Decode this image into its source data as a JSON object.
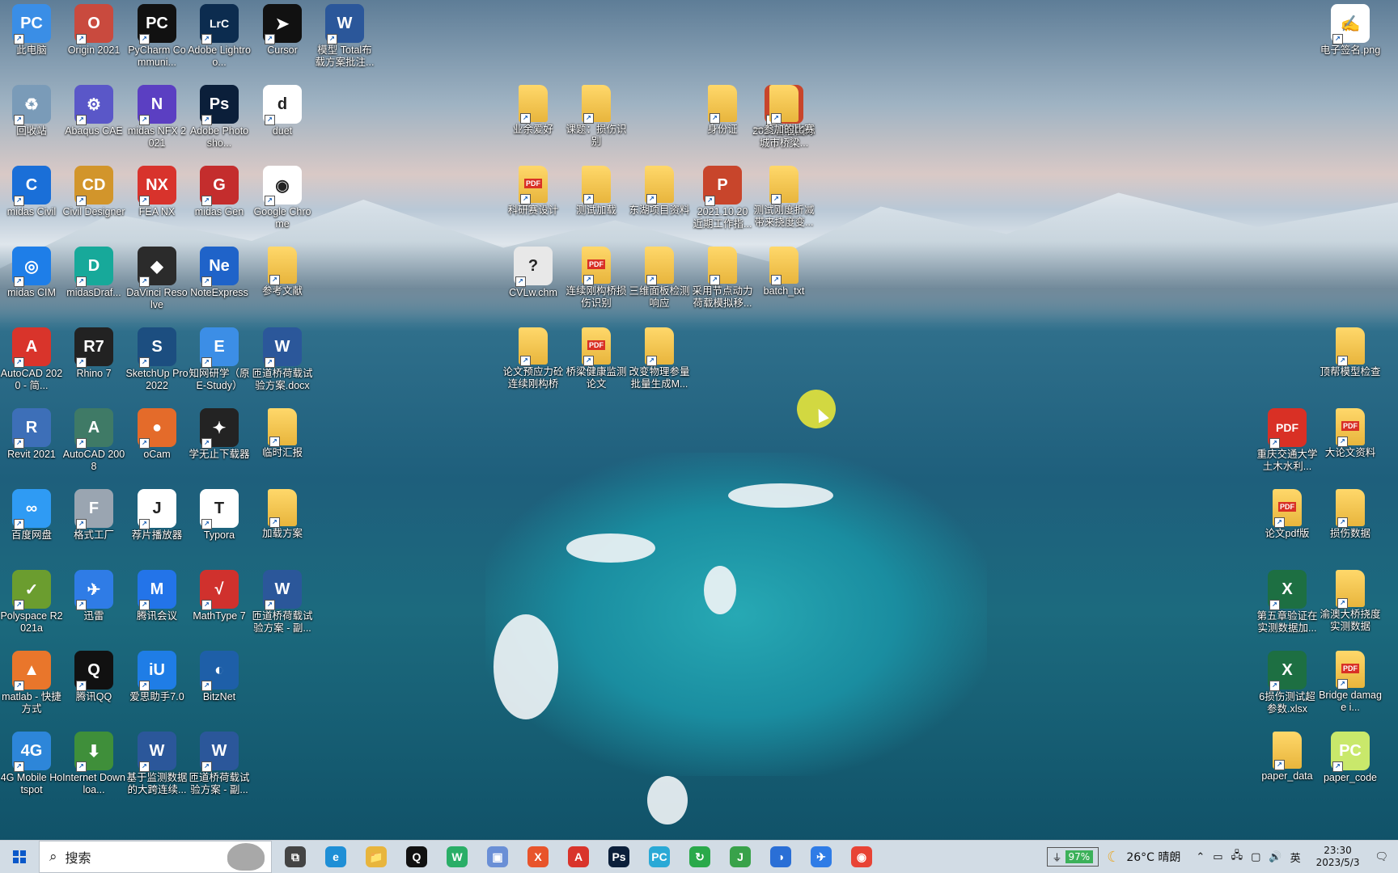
{
  "desktop": {
    "col1": [
      {
        "label": "此电脑",
        "color": "#3a8ee6",
        "glyph": "PC",
        "name": "this-pc"
      },
      {
        "label": "回收站",
        "color": "#7a9bb8",
        "glyph": "♻",
        "name": "recycle-bin"
      },
      {
        "label": "midas Civil",
        "color": "#1a6fd8",
        "glyph": "C",
        "name": "midas-civil"
      },
      {
        "label": "midas CIM",
        "color": "#1e7ee8",
        "glyph": "◎",
        "name": "midas-cim"
      },
      {
        "label": "AutoCAD 2020 - 简...",
        "color": "#d9342b",
        "glyph": "A",
        "name": "autocad-2020"
      },
      {
        "label": "Revit 2021",
        "color": "#3d6fb8",
        "glyph": "R",
        "name": "revit-2021"
      },
      {
        "label": "百度网盘",
        "color": "#2f9bf4",
        "glyph": "∞",
        "name": "baidu-netdisk"
      },
      {
        "label": "Polyspace R2021a",
        "color": "#6b9d2f",
        "glyph": "✓",
        "name": "polyspace"
      },
      {
        "label": "matlab - 快捷方式",
        "color": "#e9762b",
        "glyph": "▲",
        "name": "matlab"
      },
      {
        "label": "4G Mobile Hotspot",
        "color": "#2d86d9",
        "glyph": "4G",
        "name": "mobile-hotspot"
      }
    ],
    "col2": [
      {
        "label": "Origin 2021",
        "color": "#c94a3e",
        "glyph": "O",
        "name": "origin-2021"
      },
      {
        "label": "Abaqus CAE",
        "color": "#5a57c8",
        "glyph": "⚙",
        "name": "abaqus"
      },
      {
        "label": "Civil Designer",
        "color": "#d2952b",
        "glyph": "CD",
        "name": "civil-designer"
      },
      {
        "label": "midasDraf...",
        "color": "#17a99a",
        "glyph": "D",
        "name": "midas-drafter"
      },
      {
        "label": "Rhino 7",
        "color": "#222222",
        "glyph": "R7",
        "name": "rhino-7"
      },
      {
        "label": "AutoCAD 2008",
        "color": "#3f7a66",
        "glyph": "A",
        "name": "autocad-2008"
      },
      {
        "label": "格式工厂",
        "color": "#9aa5b1",
        "glyph": "F",
        "name": "format-factory"
      },
      {
        "label": "迅雷",
        "color": "#2f7ce6",
        "glyph": "✈",
        "name": "xunlei"
      },
      {
        "label": "腾讯QQ",
        "color": "#111111",
        "glyph": "Q",
        "name": "tencent-qq"
      },
      {
        "label": "Internet Downloa...",
        "color": "#3f8f3a",
        "glyph": "⬇",
        "name": "idm"
      }
    ],
    "col3": [
      {
        "label": "PyCharm Communi...",
        "color": "#111111",
        "glyph": "PC",
        "name": "pycharm"
      },
      {
        "label": "midas NFX 2021",
        "color": "#5b3fc2",
        "glyph": "N",
        "name": "midas-nfx"
      },
      {
        "label": "FEA NX",
        "color": "#d8332c",
        "glyph": "NX",
        "name": "fea-nx"
      },
      {
        "label": "DaVinci Resolve",
        "color": "#2b2b2b",
        "glyph": "◆",
        "name": "davinci-resolve"
      },
      {
        "label": "SketchUp Pro 2022",
        "color": "#1c4e80",
        "glyph": "S",
        "name": "sketchup"
      },
      {
        "label": "oCam",
        "color": "#e46b2a",
        "glyph": "●",
        "name": "ocam"
      },
      {
        "label": "荐片播放器",
        "color": "#ffffff",
        "glyph": "J",
        "name": "jianpian-player"
      },
      {
        "label": "腾讯会议",
        "color": "#2374e9",
        "glyph": "M",
        "name": "tencent-meeting"
      },
      {
        "label": "爱思助手7.0",
        "color": "#1f7de6",
        "glyph": "iU",
        "name": "aisi-helper"
      },
      {
        "label": "基于监测数据的大跨连续...",
        "color": "#2b579a",
        "glyph": "W",
        "name": "doc-monitoring"
      }
    ],
    "col4": [
      {
        "label": "Adobe Lightroo...",
        "color": "#0c2c4f",
        "glyph": "LrC",
        "name": "lightroom"
      },
      {
        "label": "Adobe Photosho...",
        "color": "#0b1f3a",
        "glyph": "Ps",
        "name": "photoshop"
      },
      {
        "label": "midas Gen",
        "color": "#c42d2d",
        "glyph": "G",
        "name": "midas-gen"
      },
      {
        "label": "NoteExpress",
        "color": "#1f63c9",
        "glyph": "Ne",
        "name": "noteexpress"
      },
      {
        "label": "知网研学（原E-Study）",
        "color": "#3c8ee6",
        "glyph": "E",
        "name": "e-study"
      },
      {
        "label": "学无止下载器",
        "color": "#232323",
        "glyph": "✦",
        "name": "xuewuzhi-downloader"
      },
      {
        "label": "Typora",
        "color": "#ffffff",
        "glyph": "T",
        "name": "typora"
      },
      {
        "label": "MathType 7",
        "color": "#d0312d",
        "glyph": "√",
        "name": "mathtype"
      },
      {
        "label": "BitzNet",
        "color": "#1e5fa8",
        "glyph": "◐",
        "name": "bitznet"
      },
      {
        "label": "匝道桥荷载试验方案 - 副...",
        "color": "#2b579a",
        "glyph": "W",
        "name": "doc-ramp-bridge-copy2"
      }
    ],
    "col5": [
      {
        "label": "Cursor",
        "color": "#111111",
        "glyph": "➤",
        "name": "cursor-app"
      },
      {
        "label": "duet",
        "color": "#ffffff",
        "glyph": "d",
        "name": "duet"
      },
      {
        "label": "Google Chrome",
        "color": "#ffffff",
        "glyph": "◉",
        "name": "google-chrome"
      },
      {
        "label": "参考文献",
        "folder": true,
        "name": "folder-references"
      },
      {
        "label": "匝道桥荷载试验方案.docx",
        "color": "#2b579a",
        "glyph": "W",
        "name": "doc-ramp-bridge"
      },
      {
        "label": "临时汇报",
        "folder": true,
        "name": "folder-temp-report"
      },
      {
        "label": "加载方案",
        "folder": true,
        "name": "folder-loading-plan"
      },
      {
        "label": "匝道桥荷载试验方案 - 副...",
        "color": "#2b579a",
        "glyph": "W",
        "name": "doc-ramp-bridge-copy"
      }
    ],
    "col6": [
      {
        "label": "模型 Total布载方案批注...",
        "color": "#2b579a",
        "glyph": "W",
        "name": "doc-model-total"
      }
    ],
    "mid": [
      {
        "label": "业余爱好",
        "folder": true,
        "name": "folder-hobby"
      },
      {
        "label": "课题：损伤识别",
        "folder": true,
        "name": "folder-damage-id"
      },
      {
        "label": "身份证",
        "folder": true,
        "name": "folder-id-card"
      },
      {
        "label": "2021首届国际城市桥梁...",
        "color": "#c8452b",
        "glyph": "P",
        "name": "ppt-bridge-conf"
      },
      {
        "label": "一参加的比赛",
        "folder": true,
        "name": "folder-competition"
      },
      {
        "label": "科研赛设计",
        "folder": true,
        "pdf": true,
        "name": "folder-research-design"
      },
      {
        "label": "测试加载",
        "folder": true,
        "name": "folder-test-loading"
      },
      {
        "label": "东湖项目资料",
        "folder": true,
        "name": "folder-donghu"
      },
      {
        "label": "2021.10.20 近期工作指...",
        "color": "#c8452b",
        "glyph": "P",
        "name": "ppt-recent-work"
      },
      {
        "label": "测试刚度折减带来挠度变...",
        "folder": true,
        "name": "folder-stiffness-test"
      },
      {
        "label": "CVLw.chm",
        "color": "#e8e8e8",
        "glyph": "?",
        "name": "file-cvlw-chm"
      },
      {
        "label": "连续刚构桥损伤识别",
        "folder": true,
        "pdf": true,
        "name": "folder-rigid-frame"
      },
      {
        "label": "三维面板检测响应",
        "folder": true,
        "name": "folder-3d-panel"
      },
      {
        "label": "采用节点动力荷载模拟移...",
        "folder": true,
        "name": "folder-node-load"
      },
      {
        "label": "batch_txt",
        "folder": true,
        "name": "folder-batch-txt"
      },
      {
        "label": "论文预应力砼连续刚构桥",
        "folder": true,
        "name": "folder-prestressed"
      },
      {
        "label": "桥梁健康监测论文",
        "folder": true,
        "pdf": true,
        "name": "folder-shm-paper"
      },
      {
        "label": "改变物理参量批量生成M...",
        "folder": true,
        "name": "folder-batch-generate"
      }
    ],
    "right": [
      {
        "label": "电子签名.png",
        "color": "#ffffff",
        "glyph": "✍",
        "name": "file-signature"
      },
      {
        "label": "顶帮模型检查",
        "folder": true,
        "name": "folder-model-check"
      },
      {
        "label": "重庆交通大学土木水利...",
        "color": "#d93025",
        "glyph": "PDF",
        "name": "pdf-cqjtu"
      },
      {
        "label": "大论文资料",
        "folder": true,
        "pdf": true,
        "name": "folder-thesis-materials"
      },
      {
        "label": "论文pdf版",
        "folder": true,
        "pdf": true,
        "name": "folder-thesis-pdf"
      },
      {
        "label": "损伤数据",
        "folder": true,
        "name": "folder-damage-data"
      },
      {
        "label": "第五章验证在实测数据加...",
        "color": "#1d6f42",
        "glyph": "X",
        "name": "xlsx-chapter5"
      },
      {
        "label": "渝澳大桥挠度实测数据",
        "folder": true,
        "name": "folder-yuao-bridge"
      },
      {
        "label": "6损伤测试超参数.xlsx",
        "color": "#1d6f42",
        "glyph": "X",
        "name": "xlsx-hyperparams"
      },
      {
        "label": "Bridge damage i...",
        "folder": true,
        "pdf": true,
        "name": "folder-bridge-damage"
      },
      {
        "label": "paper_data",
        "folder": true,
        "name": "folder-paper-data"
      },
      {
        "label": "paper_code",
        "color": "#c9e86b",
        "glyph": "PC",
        "name": "folder-paper-code"
      }
    ]
  },
  "taskbar": {
    "search_placeholder": "搜索",
    "apps": [
      {
        "name": "task-view",
        "glyph": "⧉",
        "color": "#444444"
      },
      {
        "name": "edge",
        "glyph": "e",
        "color": "#1f8fd6"
      },
      {
        "name": "file-explorer",
        "glyph": "📁",
        "color": "#e8b53d"
      },
      {
        "name": "qq",
        "glyph": "Q",
        "color": "#111111"
      },
      {
        "name": "wechat",
        "glyph": "W",
        "color": "#2aae67"
      },
      {
        "name": "image-viewer",
        "glyph": "▣",
        "color": "#6a8fd6"
      },
      {
        "name": "xmind",
        "glyph": "X",
        "color": "#e8542b"
      },
      {
        "name": "acrobat",
        "glyph": "A",
        "color": "#d9342b"
      },
      {
        "name": "photoshop",
        "glyph": "Ps",
        "color": "#0b1f3a"
      },
      {
        "name": "pycharm",
        "glyph": "PC",
        "color": "#2aa9d6"
      },
      {
        "name": "refresh-tool",
        "glyph": "↻",
        "color": "#2aa94a"
      },
      {
        "name": "jupyter",
        "glyph": "J",
        "color": "#39a24a"
      },
      {
        "name": "browser-2",
        "glyph": "◑",
        "color": "#2a6fd6"
      },
      {
        "name": "xunlei",
        "glyph": "✈",
        "color": "#2f7ce6"
      },
      {
        "name": "chrome",
        "glyph": "◉",
        "color": "#e84335"
      }
    ],
    "battery": "97%",
    "weather": "26°C 晴朗",
    "ime": "英",
    "time": "23:30",
    "date": "2023/5/3"
  }
}
